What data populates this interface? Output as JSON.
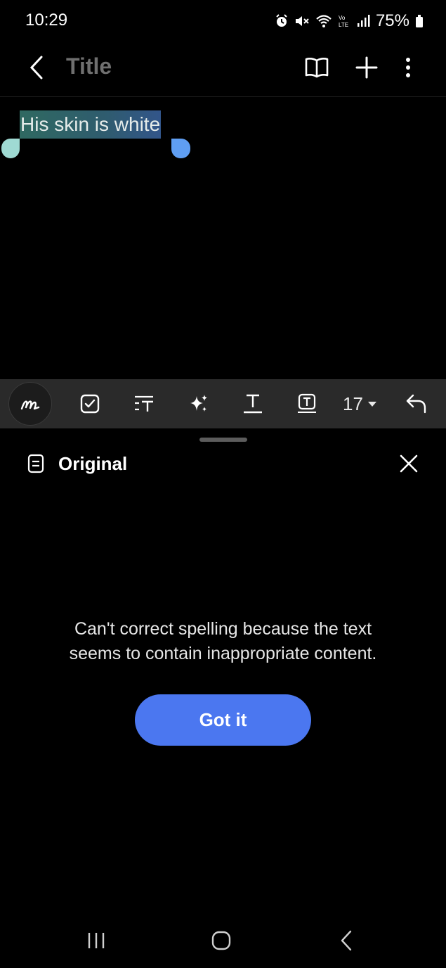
{
  "status_bar": {
    "time": "10:29",
    "battery": "75%",
    "icons": [
      "alarm-icon",
      "mute-icon",
      "wifi-icon",
      "volte-icon",
      "signal-icon",
      "battery-icon"
    ]
  },
  "app_bar": {
    "title": "Title",
    "icons": [
      "back-icon",
      "book-icon",
      "plus-icon",
      "more-icon"
    ]
  },
  "note": {
    "selected_text": "His skin is white"
  },
  "toolbar": {
    "icons": [
      "pen-icon",
      "checkbox-icon",
      "text-format-icon",
      "ai-sparkle-icon",
      "text-underline-icon",
      "text-box-icon",
      "undo-icon"
    ],
    "font_size": "17"
  },
  "sheet": {
    "title": "Original",
    "message_line1": "Can't correct spelling because the text",
    "message_line2": "seems to contain inappropriate content.",
    "button_label": "Got it"
  },
  "nav_bar": {
    "icons": [
      "recents-icon",
      "home-icon",
      "back-nav-icon"
    ]
  },
  "colors": {
    "background": "#000000",
    "toolbar": "#2a2a2a",
    "accent_button": "#4b77f0",
    "selection_start": "#2f6961",
    "selection_end": "#32558a",
    "handle_left": "#9fdad3",
    "handle_right": "#5f9ef2"
  }
}
